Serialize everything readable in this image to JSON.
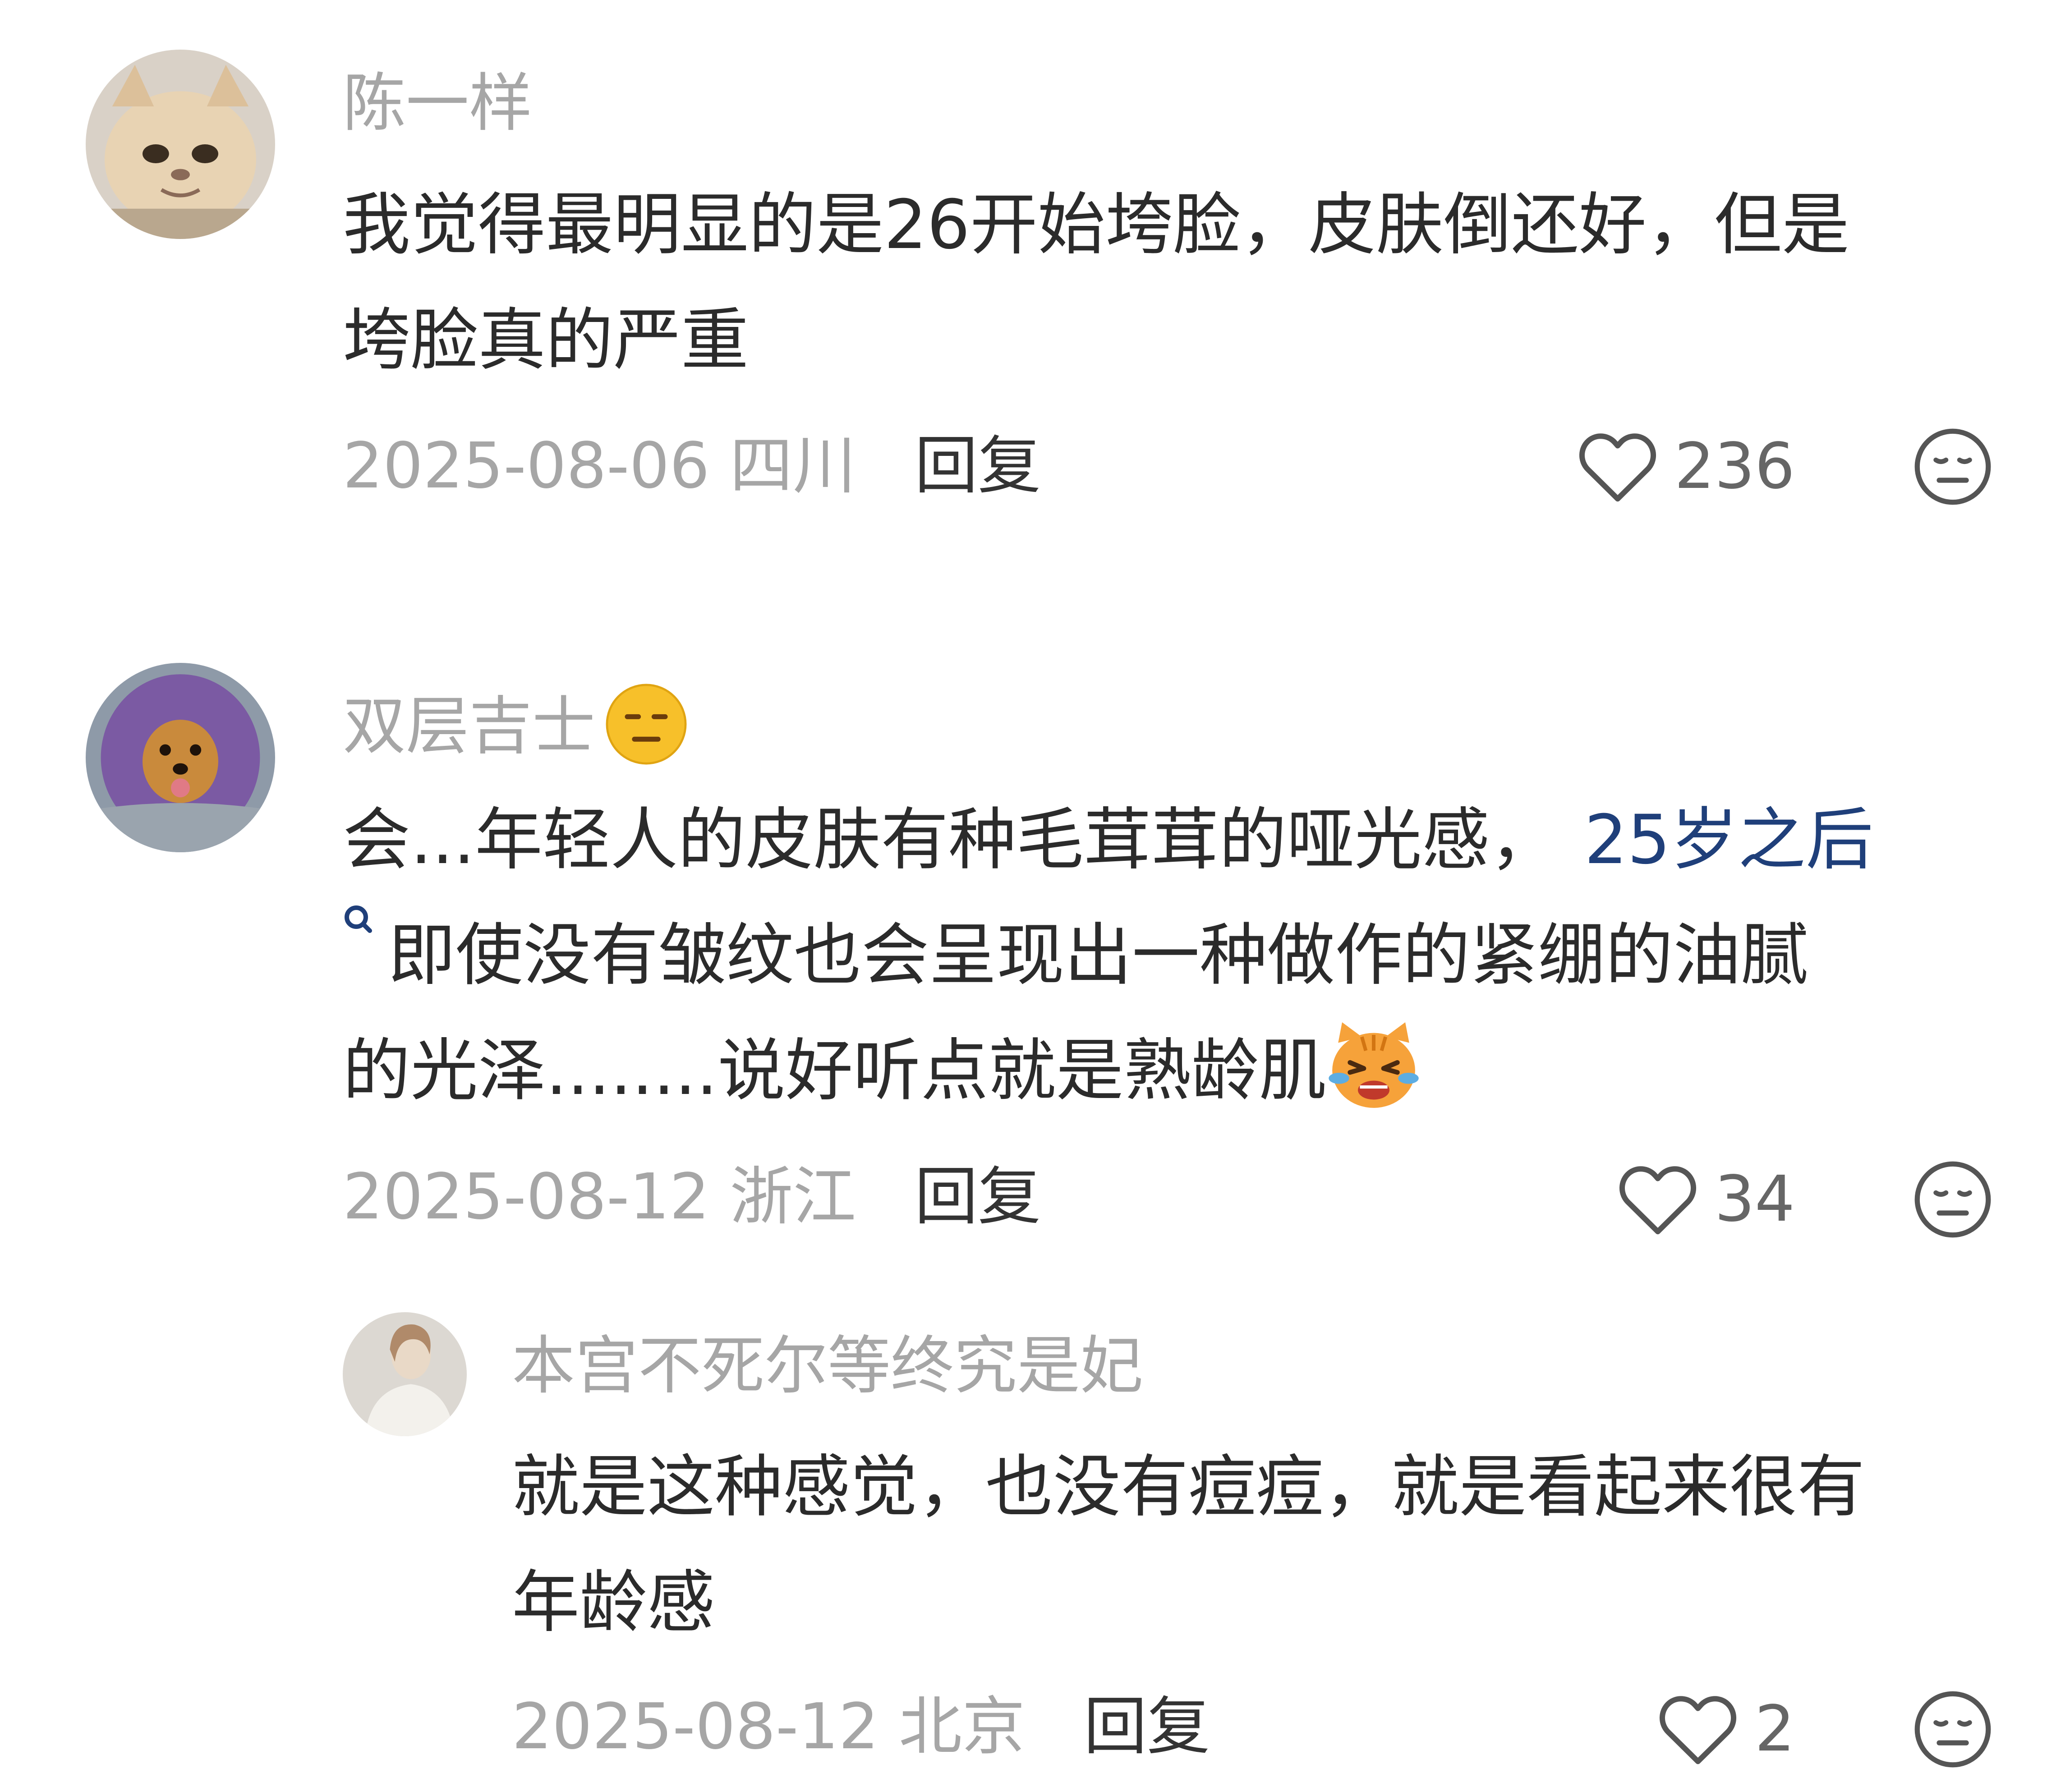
{
  "comments": [
    {
      "username": "陈一样",
      "text_lines": [
        "我觉得最明显的是26开始垮脸，皮肤倒还好，但是",
        "垮脸真的严重"
      ],
      "date_location": "2025-08-06 四川",
      "reply_label": "回复",
      "likes": "236"
    },
    {
      "username": "双层吉士",
      "name_emoji": "expressionless-face-emoji",
      "text_line1_prefix": "会...年轻人的皮肤有种毛茸茸的哑光感，",
      "text_line1_link": "25岁之后",
      "text_line2": "即使没有皱纹也会呈现出一种做作的紧绷的油腻",
      "text_line3": "的光泽........说好听点就是熟龄肌",
      "inline_emoji": "crying-cat-emoji",
      "date_location": "2025-08-12 浙江",
      "reply_label": "回复",
      "likes": "34"
    },
    {
      "username": "本宫不死尔等终究是妃",
      "text_lines": [
        "就是这种感觉，也没有痘痘，就是看起来很有",
        "年龄感"
      ],
      "date_location": "2025-08-12 北京",
      "reply_label": "回复",
      "likes": "2"
    }
  ],
  "colors": {
    "username": "#a6a6a6",
    "body": "#2b2b2b",
    "link": "#1f3f7a",
    "icon": "#555555"
  }
}
